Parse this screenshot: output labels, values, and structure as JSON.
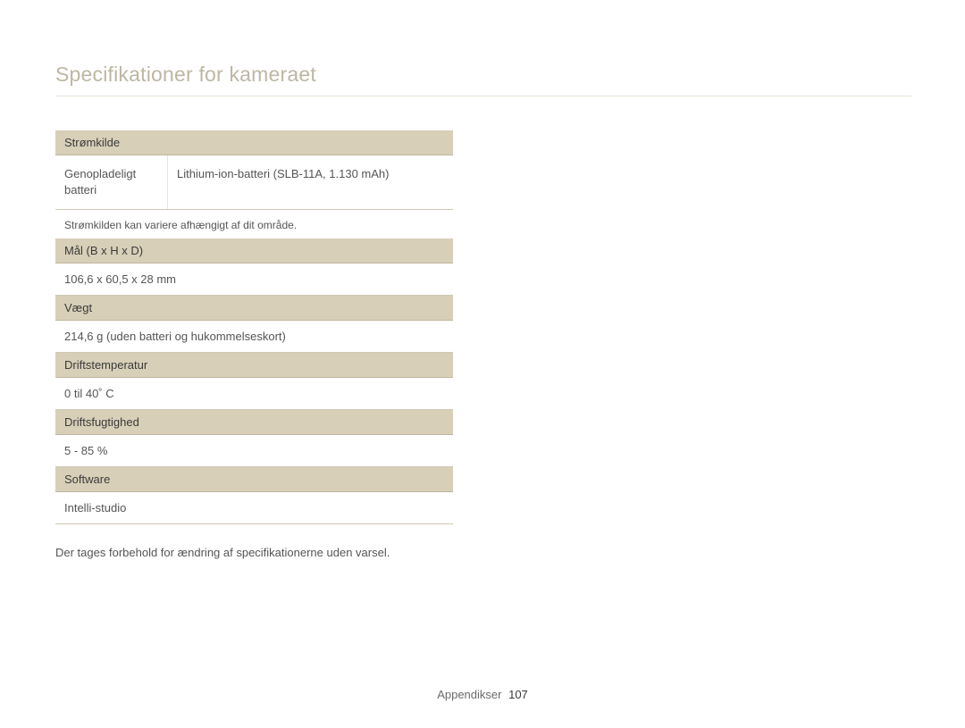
{
  "title": "Specifikationer for kameraet",
  "sections": {
    "power": {
      "header": "Strømkilde",
      "row_label": "Genopladeligt batteri",
      "row_value": "Lithium-ion-batteri (SLB-11A, 1.130 mAh)",
      "note": "Strømkilden kan variere afhængigt af dit område."
    },
    "dims": {
      "header": "Mål (B x H x D)",
      "value": "106,6 x 60,5 x 28 mm"
    },
    "weight": {
      "header": "Vægt",
      "value": "214,6 g (uden batteri og hukommelseskort)"
    },
    "optemp": {
      "header": "Driftstemperatur",
      "value": "0 til 40˚ C"
    },
    "ophum": {
      "header": "Driftsfugtighed",
      "value": "5 - 85 %"
    },
    "software": {
      "header": "Software",
      "value": "Intelli-studio"
    }
  },
  "disclaimer": "Der tages forbehold for ændring af specifikationerne uden varsel.",
  "footer": {
    "section": "Appendikser",
    "page": "107"
  }
}
